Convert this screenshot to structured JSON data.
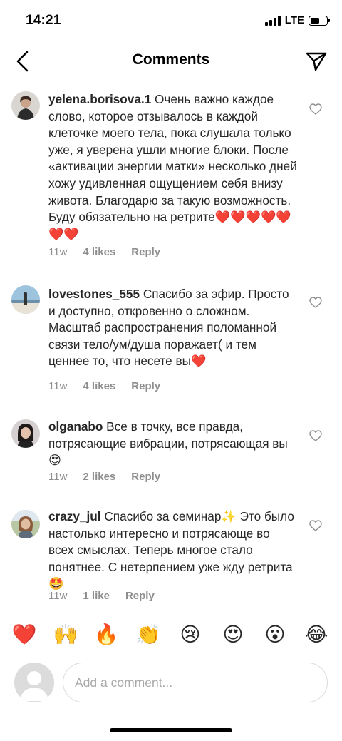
{
  "status_bar": {
    "time": "14:21",
    "network": "LTE",
    "battery_level": 0.55
  },
  "header": {
    "title": "Comments",
    "back_icon": "chevron-left-icon",
    "send_icon": "paper-plane-icon"
  },
  "comments": [
    {
      "username": "yelena.borisova.1",
      "text": "Очень важно каждое слово, которое отзывалось в каждой клеточке моего тела, пока слушала только уже, я уверена ушли многие блоки. После «активации энергии матки» несколько дней хожу удивленная ощущением себя внизу живота. Благодарю за такую возможность. Буду обязательно на ретрите❤️❤️❤️❤️❤️❤️❤️",
      "time": "11w",
      "likes": "4 likes",
      "reply": "Reply"
    },
    {
      "username": "lovestones_555",
      "text": "Спасибо за эфир. Просто и доступно, откровенно о сложном.  Масштаб распространения поломанной связи тело/ум/душа поражает( и тем ценнее то, что несете вы❤️",
      "time": "11w",
      "likes": "4 likes",
      "reply": "Reply"
    },
    {
      "username": "olganabo",
      "text": "Все в точку, все правда, потрясающие вибрации, потрясающая вы😍",
      "time": "11w",
      "likes": "2 likes",
      "reply": "Reply"
    },
    {
      "username": "crazy_jul",
      "text": "Спасибо за семинар✨ Это было настолько интересно и потрясающе во всех смыслах. Теперь многое стало понятнее. С нетерпением уже жду ретрита🤩",
      "time": "11w",
      "likes": "1 like",
      "reply": "Reply"
    }
  ],
  "emoji_bar": [
    "❤️",
    "🙌",
    "🔥",
    "👏",
    "😢",
    "😍",
    "😮",
    "😂"
  ],
  "input": {
    "placeholder": "Add a comment..."
  },
  "colors": {
    "text": "#262626",
    "muted": "#8e8e8e",
    "divider": "#dbdbdb",
    "heart_red": "#ed2d3d"
  }
}
